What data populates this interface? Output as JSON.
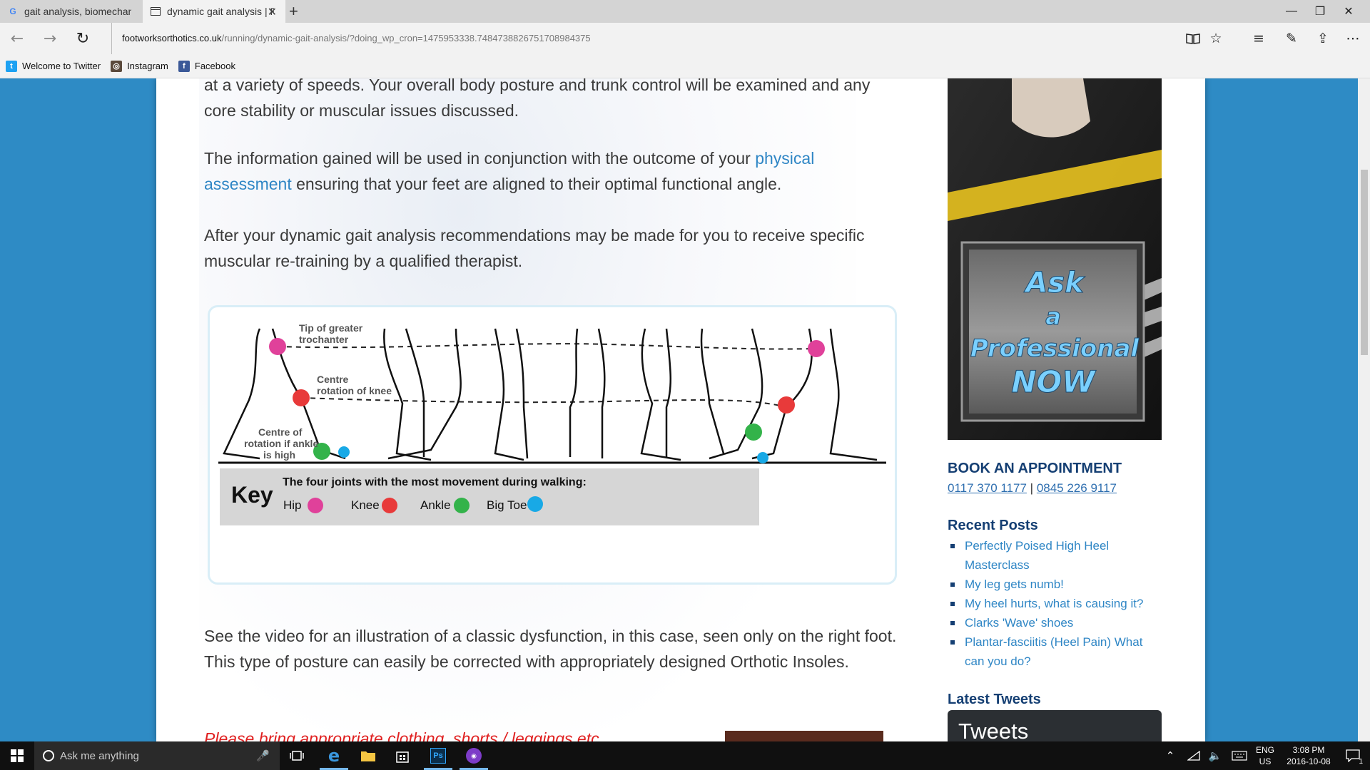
{
  "browser": {
    "tabs": [
      {
        "title": "gait analysis, biomechanics",
        "icon": "google-icon",
        "active": false
      },
      {
        "title": "dynamic gait analysis | F",
        "icon": "page-icon",
        "active": true
      }
    ],
    "new_tab": "+",
    "url_host": "footworksorthotics.co.uk",
    "url_path": "/running/dynamic-gait-analysis/?doing_wp_cron=1475953338.7484738826751708984375",
    "favorites": [
      {
        "label": "Welcome to Twitter",
        "icon": "twitter-icon"
      },
      {
        "label": "Instagram",
        "icon": "instagram-icon"
      },
      {
        "label": "Facebook",
        "icon": "facebook-icon"
      }
    ]
  },
  "article": {
    "p1": "at a variety of speeds. Your overall body posture and trunk control will be examined and any core stability or muscular issues discussed.",
    "p2_before": "The information gained will be used in conjunction with the outcome of your ",
    "p2_link": "physical assessment",
    "p2_after": " ensuring that your feet are aligned to their optimal functional angle.",
    "p3": "After your dynamic gait analysis recommendations may be made for you to receive specific muscular re-training by a qualified therapist.",
    "p4": "See the video for an illustration of a classic dysfunction, in this case, seen only on the right foot.  This type of posture can easily be corrected with appropriately designed Orthotic Insoles.",
    "p5": "Please bring appropriate clothing, shorts / leggings etc."
  },
  "diagram": {
    "label_hip": "Tip of greater trochanter",
    "label_hip_1": "Tip of greater",
    "label_hip_2": "trochanter",
    "label_knee_1": "Centre",
    "label_knee_2": "rotation of knee",
    "label_ankle_1": "Centre of",
    "label_ankle_2": "rotation if ankle",
    "label_ankle_3": "is high",
    "key_title": "Key",
    "key_caption": "The four joints with the most movement during walking:",
    "key_items": [
      {
        "label": "Hip",
        "color": "#e0419a"
      },
      {
        "label": "Knee",
        "color": "#e83a3a"
      },
      {
        "label": "Ankle",
        "color": "#33b34a"
      },
      {
        "label": "Big Toe",
        "color": "#18a9e6"
      }
    ]
  },
  "sidebar": {
    "ad_line1": "Ask",
    "ad_line2": "a",
    "ad_line3": "Professional",
    "ad_line4": "NOW",
    "book_heading": "BOOK AN APPOINTMENT",
    "phone1": "0117 370 1177",
    "phone_sep": " | ",
    "phone2": "0845 226 9117",
    "recent_heading": "Recent Posts",
    "recent_posts": [
      "Perfectly Poised High Heel Masterclass",
      "My leg gets numb!",
      "My heel hurts, what is causing it?",
      "Clarks 'Wave' shoes",
      "Plantar-fasciitis (Heel Pain) What can you do?"
    ],
    "tweets_heading": "Latest Tweets",
    "tweets_box": "Tweets"
  },
  "taskbar": {
    "search_placeholder": "Ask me anything",
    "lang_1": "ENG",
    "lang_2": "US",
    "time": "3:08 PM",
    "date": "2016-10-08",
    "notif_count": "1"
  },
  "colors": {
    "page_bg": "#2e8bc5",
    "link": "#2f86c5",
    "heading": "#153f73",
    "hip": "#e0419a",
    "knee": "#e83a3a",
    "ankle": "#33b34a",
    "toe": "#18a9e6"
  }
}
